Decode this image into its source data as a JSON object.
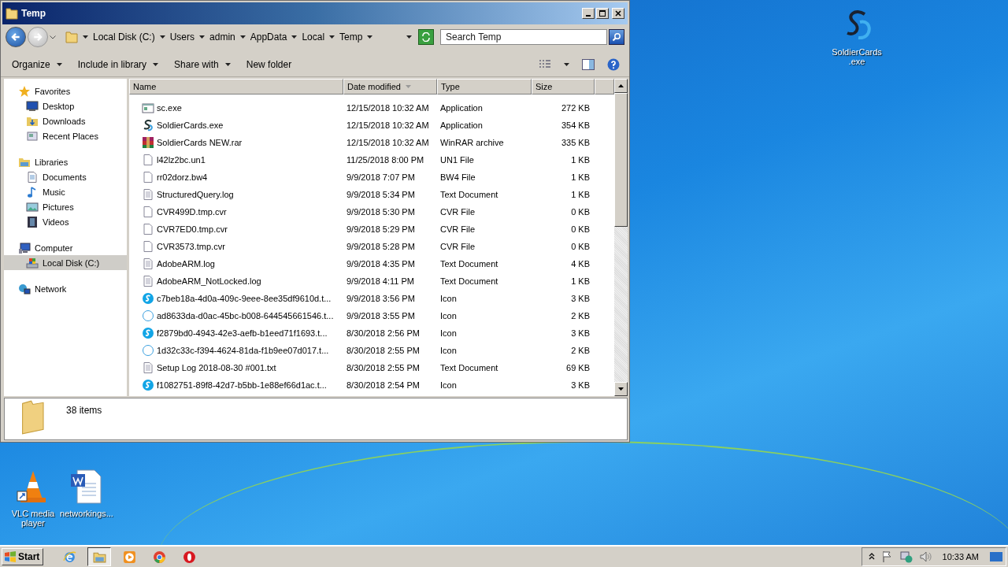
{
  "window": {
    "title": "Temp"
  },
  "breadcrumb": [
    "Local Disk (C:)",
    "Users",
    "admin",
    "AppData",
    "Local",
    "Temp"
  ],
  "search": {
    "placeholder": "Search Temp"
  },
  "toolbar": [
    {
      "label": "Organize",
      "menu": true
    },
    {
      "label": "Include in library",
      "menu": true
    },
    {
      "label": "Share with",
      "menu": true
    },
    {
      "label": "New folder",
      "menu": false
    }
  ],
  "navigation": [
    {
      "label": "Favorites",
      "kind": "star",
      "children": [
        {
          "label": "Desktop",
          "kind": "desktop",
          "selected": false
        },
        {
          "label": "Downloads",
          "kind": "downloads",
          "selected": false
        },
        {
          "label": "Recent Places",
          "kind": "recent",
          "selected": false
        }
      ]
    },
    {
      "label": "Libraries",
      "kind": "libraries",
      "children": [
        {
          "label": "Documents",
          "kind": "documents",
          "selected": false
        },
        {
          "label": "Music",
          "kind": "music",
          "selected": false
        },
        {
          "label": "Pictures",
          "kind": "pictures",
          "selected": false
        },
        {
          "label": "Videos",
          "kind": "videos",
          "selected": false
        }
      ]
    },
    {
      "label": "Computer",
      "kind": "computer",
      "children": [
        {
          "label": "Local Disk (C:)",
          "kind": "disk",
          "selected": true
        }
      ]
    },
    {
      "label": "Network",
      "kind": "network"
    }
  ],
  "columns": [
    {
      "label": "Name",
      "sorted": false
    },
    {
      "label": "Date modified",
      "sorted": true
    },
    {
      "label": "Type",
      "sorted": false
    },
    {
      "label": "Size",
      "sorted": false
    }
  ],
  "files": [
    {
      "name": "sc.exe",
      "date": "12/15/2018 10:32 AM",
      "type": "Application",
      "size": "272 KB",
      "kind": "app"
    },
    {
      "name": "SoldierCards.exe",
      "date": "12/15/2018 10:32 AM",
      "type": "Application",
      "size": "354 KB",
      "kind": "sc"
    },
    {
      "name": "SoldierCards NEW.rar",
      "date": "12/15/2018 10:32 AM",
      "type": "WinRAR archive",
      "size": "335 KB",
      "kind": "rar"
    },
    {
      "name": "l42lz2bc.un1",
      "date": "11/25/2018 8:00 PM",
      "type": "UN1 File",
      "size": "1 KB",
      "kind": "blank"
    },
    {
      "name": "rr02dorz.bw4",
      "date": "9/9/2018 7:07 PM",
      "type": "BW4 File",
      "size": "1 KB",
      "kind": "blank"
    },
    {
      "name": "StructuredQuery.log",
      "date": "9/9/2018 5:34 PM",
      "type": "Text Document",
      "size": "1 KB",
      "kind": "text"
    },
    {
      "name": "CVR499D.tmp.cvr",
      "date": "9/9/2018 5:30 PM",
      "type": "CVR File",
      "size": "0 KB",
      "kind": "blank"
    },
    {
      "name": "CVR7ED0.tmp.cvr",
      "date": "9/9/2018 5:29 PM",
      "type": "CVR File",
      "size": "0 KB",
      "kind": "blank"
    },
    {
      "name": "CVR3573.tmp.cvr",
      "date": "9/9/2018 5:28 PM",
      "type": "CVR File",
      "size": "0 KB",
      "kind": "blank"
    },
    {
      "name": "AdobeARM.log",
      "date": "9/9/2018 4:35 PM",
      "type": "Text Document",
      "size": "4 KB",
      "kind": "text"
    },
    {
      "name": "AdobeARM_NotLocked.log",
      "date": "9/9/2018 4:11 PM",
      "type": "Text Document",
      "size": "1 KB",
      "kind": "text"
    },
    {
      "name": "c7beb18a-4d0a-409c-9eee-8ee35df9610d.t...",
      "date": "9/9/2018 3:56 PM",
      "type": "Icon",
      "size": "3 KB",
      "kind": "chat"
    },
    {
      "name": "ad8633da-d0ac-45bc-b008-644545661546.t...",
      "date": "9/9/2018 3:55 PM",
      "type": "Icon",
      "size": "2 KB",
      "kind": "outline"
    },
    {
      "name": "f2879bd0-4943-42e3-aefb-b1eed71f1693.t...",
      "date": "8/30/2018 2:56 PM",
      "type": "Icon",
      "size": "3 KB",
      "kind": "chat"
    },
    {
      "name": "1d32c33c-f394-4624-81da-f1b9ee07d017.t...",
      "date": "8/30/2018 2:55 PM",
      "type": "Icon",
      "size": "2 KB",
      "kind": "outline"
    },
    {
      "name": "Setup Log 2018-08-30 #001.txt",
      "date": "8/30/2018 2:55 PM",
      "type": "Text Document",
      "size": "69 KB",
      "kind": "text"
    },
    {
      "name": "f1082751-89f8-42d7-b5bb-1e88ef66d1ac.t...",
      "date": "8/30/2018 2:54 PM",
      "type": "Icon",
      "size": "3 KB",
      "kind": "chat"
    }
  ],
  "details": {
    "count": "38 items"
  },
  "desktop_icons": [
    {
      "lines": [
        "SoldierCards",
        ".exe"
      ],
      "kind": "sc"
    },
    {
      "lines": [
        "VLC media",
        "player"
      ],
      "kind": "vlc"
    },
    {
      "lines": [
        "networkings..."
      ],
      "kind": "word"
    }
  ],
  "taskbar": {
    "start": "Start",
    "apps": [
      {
        "kind": "ie",
        "selected": false
      },
      {
        "kind": "folder",
        "selected": true
      },
      {
        "kind": "media",
        "selected": false
      },
      {
        "kind": "chrome",
        "selected": false
      },
      {
        "kind": "opera",
        "selected": false
      }
    ],
    "clock": "10:33 AM"
  }
}
